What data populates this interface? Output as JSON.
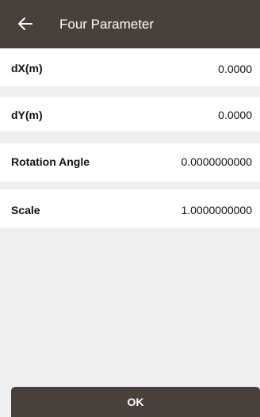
{
  "header": {
    "title": "Four Parameter",
    "back_icon": "arrow-left-icon"
  },
  "params": [
    {
      "label": "dX(m)",
      "value": "0.0000"
    },
    {
      "label": "dY(m)",
      "value": "0.0000"
    },
    {
      "label": "Rotation Angle",
      "value": "0.0000000000"
    },
    {
      "label": "Scale",
      "value": "1.0000000000"
    }
  ],
  "footer": {
    "ok_label": "OK"
  },
  "colors": {
    "bar": "#4a403b",
    "background": "#efeff1",
    "card": "#ffffff"
  }
}
